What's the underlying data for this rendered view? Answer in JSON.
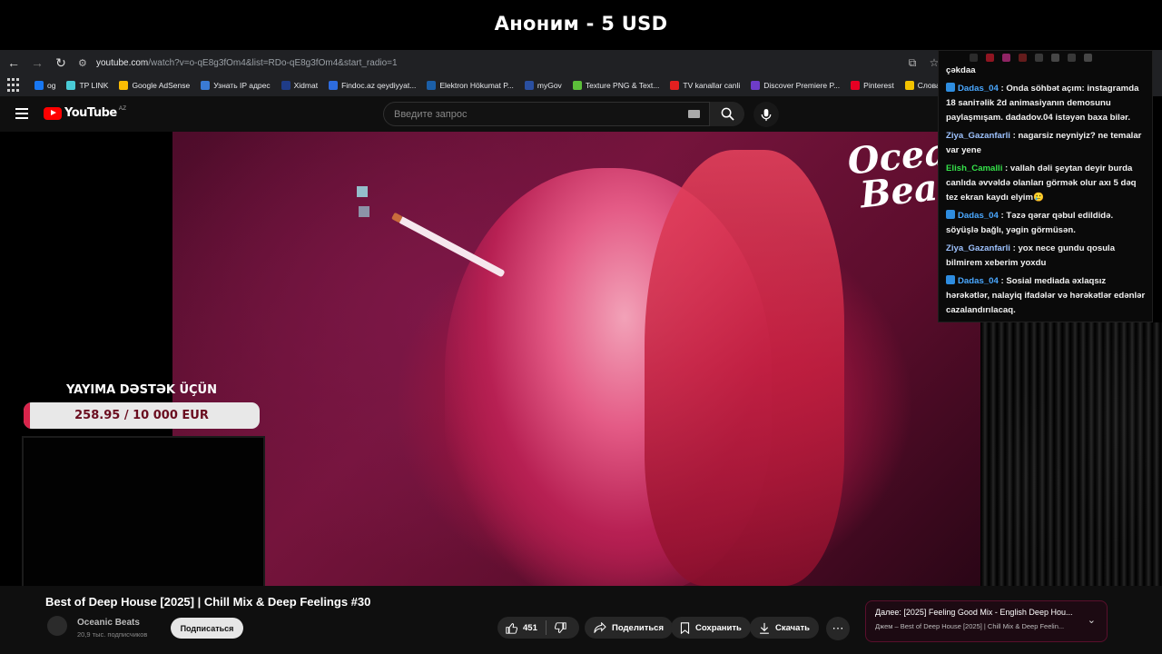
{
  "donation": {
    "text": "Аноним - 5 USD"
  },
  "browser": {
    "url_main": "youtube.com",
    "url_rest": "/watch?v=o-qE8g3fOm4&list=RDo-qE8g3fOm4&start_radio=1",
    "bookmarks": [
      {
        "label": "og",
        "color": "#1877f2"
      },
      {
        "label": "TP LINK",
        "color": "#4acbd6"
      },
      {
        "label": "Google AdSense",
        "color": "#fbbc04"
      },
      {
        "label": "Узнать IP адрес",
        "color": "#3a7bd5"
      },
      {
        "label": "Xidmat",
        "color": "#1f3c88"
      },
      {
        "label": "Findoc.az qeydiyyat...",
        "color": "#2d6cdf"
      },
      {
        "label": "Elektron Hökumat P...",
        "color": "#1b5fa8"
      },
      {
        "label": "myGov",
        "color": "#2a4fa0"
      },
      {
        "label": "Texture PNG & Text...",
        "color": "#5cbf3a"
      },
      {
        "label": "TV kanallar canli",
        "color": "#e52020"
      },
      {
        "label": "Discover Premiere P...",
        "color": "#6e3cc9"
      },
      {
        "label": "Pinterest",
        "color": "#e60023"
      },
      {
        "label": "Словарь игровых т...",
        "color": "#f2c200"
      }
    ]
  },
  "youtube": {
    "logo": "YouTube",
    "country": "AZ",
    "search_placeholder": "Введите запрос"
  },
  "video": {
    "watermark_1": "Oceanic",
    "watermark_2": "Beats",
    "title": "Best of Deep House [2025] | Chill Mix & Deep Feelings #30",
    "channel": "Oceanic Beats",
    "subscribers": "20,9 тыс. подписчиков",
    "subscribe": "Подписаться",
    "likes": "451",
    "share": "Поделиться",
    "save": "Сохранить",
    "download": "Скачать"
  },
  "next": {
    "title": "Далее: [2025] Feeling Good Mix - English Deep Hou...",
    "subtitle": "Джем – Best of Deep House [2025] | Chill Mix & Deep Feelin..."
  },
  "goal": {
    "title": "YAYIMA DƏSTƏK ÜÇÜN",
    "text": "258.95 / 10 000 EUR",
    "raised": 258.95,
    "target": 10000
  },
  "chat": {
    "top_text": "çəkdaa",
    "messages": [
      {
        "bot": true,
        "name": "Dadas_04",
        "name_color": "#4aa8ff",
        "text": " : Onda söhbət açım: instagramda 18 saniтəlik 2d animasiyanın demosunu paylaşmışam. dadadov.04 istəyən baxa bilər."
      },
      {
        "bot": false,
        "name": "Ziya_Gazanfarli",
        "name_color": "#9ec3ff",
        "text": " : nagarsiz neyniyiz? ne temalar var yene"
      },
      {
        "bot": false,
        "name": "Elish_Camalli",
        "name_color": "#35e24a",
        "text": " : vallah dəli şeytan deyir burda canlıda əvvəldə olanları görmək olur axı 5 dəq tez ekran kaydı elyim🥲"
      },
      {
        "bot": true,
        "name": "Dadas_04",
        "name_color": "#4aa8ff",
        "text": " : Təzə qərar qəbul edildidə. söyüşlə bağlı, yəgin görmüsən."
      },
      {
        "bot": false,
        "name": "Ziya_Gazanfarli",
        "name_color": "#9ec3ff",
        "text": " : yox nece gundu qosula bilmirem xeberim yoxdu"
      },
      {
        "bot": true,
        "name": "Dadas_04",
        "name_color": "#4aa8ff",
        "text": " : Sosial mediada əxlaqsız hərəkətlər, nalayiq ifadələr və hərəkətlər edənlər cazalandırılacaq."
      }
    ]
  }
}
